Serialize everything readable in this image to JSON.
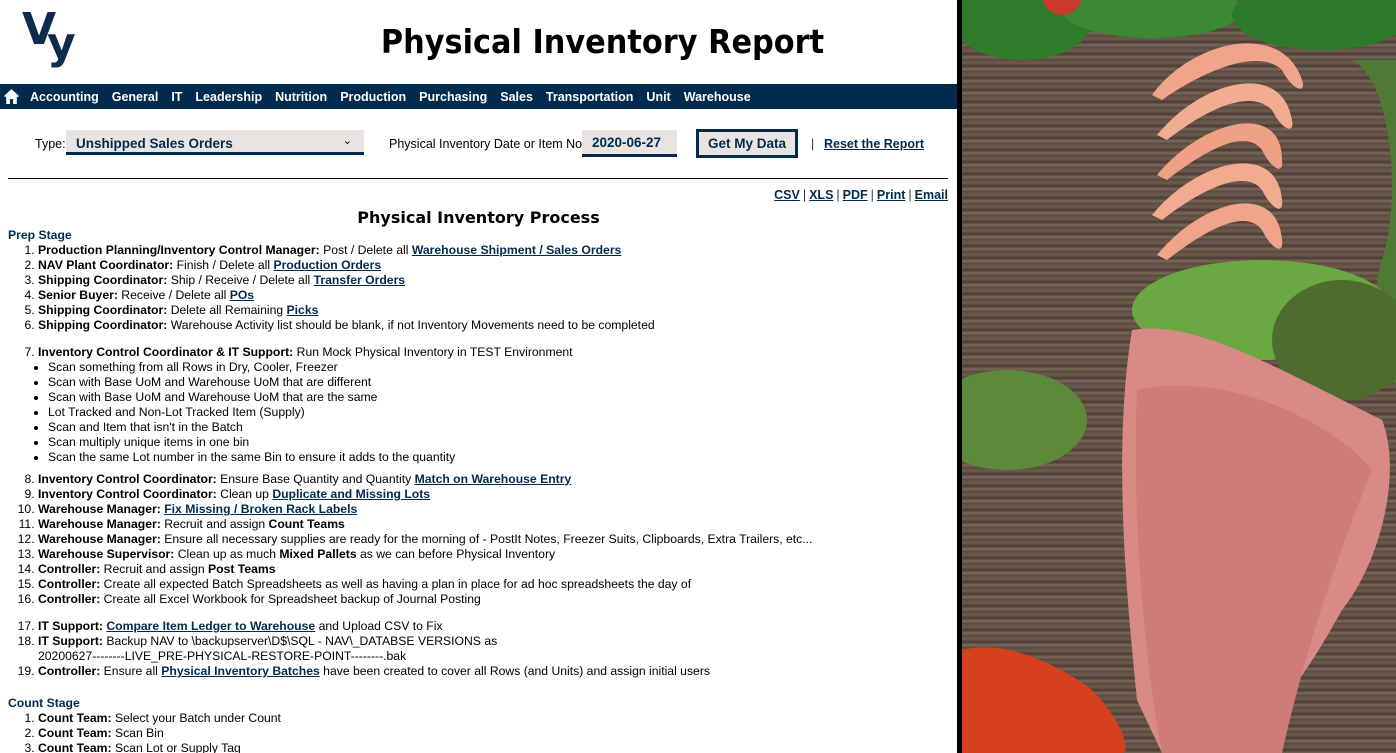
{
  "header": {
    "logo_text_v": "V",
    "logo_text_y": "y",
    "title": "Physical Inventory Report"
  },
  "nav": {
    "home_icon": "home-icon",
    "items": [
      {
        "label": "Accounting"
      },
      {
        "label": "General"
      },
      {
        "label": "IT"
      },
      {
        "label": "Leadership"
      },
      {
        "label": "Nutrition"
      },
      {
        "label": "Production"
      },
      {
        "label": "Purchasing"
      },
      {
        "label": "Sales"
      },
      {
        "label": "Transportation"
      },
      {
        "label": "Unit"
      },
      {
        "label": "Warehouse"
      }
    ]
  },
  "form": {
    "type_label": "Type:",
    "type_value": "Unshipped Sales Orders",
    "chevron": "⌄",
    "date_label": "Physical Inventory Date or Item No:",
    "date_value": "2020-06-27",
    "submit_label": "Get My Data",
    "separator": "|",
    "reset_label": "Reset the Report"
  },
  "exports": {
    "items": [
      "CSV",
      "XLS",
      "PDF",
      "Print",
      "Email"
    ],
    "separator": "|"
  },
  "process_title": "Physical Inventory Process",
  "prep_stage": {
    "heading": "Prep Stage",
    "steps": [
      {
        "role": "Production Planning/Inventory Control Manager:",
        "text": " Post / Delete all ",
        "link": "Warehouse Shipment / Sales Orders"
      },
      {
        "role": "NAV Plant Coordinator:",
        "text": " Finish / Delete all ",
        "link": "Production Orders"
      },
      {
        "role": "Shipping Coordinator:",
        "text": " Ship / Receive / Delete all ",
        "link": "Transfer Orders"
      },
      {
        "role": "Senior Buyer:",
        "text": " Receive / Delete all ",
        "link": "POs"
      },
      {
        "role": "Shipping Coordinator:",
        "text": " Delete all Remaining ",
        "link": "Picks"
      },
      {
        "role": "Shipping Coordinator:",
        "text": " Warehouse Activity list should be blank, if not Inventory Movements need to be completed"
      },
      {
        "role": "Inventory Control Coordinator & IT Support:",
        "text": " Run Mock Physical Inventory in TEST Environment"
      },
      {
        "role": "Inventory Control Coordinator:",
        "text": " Ensure Base Quantity and Quantity ",
        "link": "Match on Warehouse Entry"
      },
      {
        "role": "Inventory Control Coordinator:",
        "text": " Clean up ",
        "link": "Duplicate and Missing Lots"
      },
      {
        "role": "Warehouse Manager:",
        "text": " ",
        "link": "Fix Missing / Broken Rack Labels"
      },
      {
        "role": "Warehouse Manager:",
        "text": " Recruit and assign ",
        "bold_tail": "Count Teams"
      },
      {
        "role": "Warehouse Manager:",
        "text": " Ensure all necessary supplies are ready for the morning of - PostIt Notes, Freezer Suits, Clipboards, Extra Trailers, etc..."
      },
      {
        "role": "Warehouse Supervisor:",
        "text": " Clean up as much ",
        "bold_mid": "Mixed Pallets",
        "text2": " as we can before Physical Inventory"
      },
      {
        "role": "Controller:",
        "text": " Recruit and assign ",
        "bold_tail": "Post Teams"
      },
      {
        "role": "Controller:",
        "text": " Create all expected Batch Spreadsheets as well as having a plan in place for ad hoc spreadsheets the day of"
      },
      {
        "role": "Controller:",
        "text": " Create all Excel Workbook for Spreadsheet backup of Journal Posting"
      },
      {
        "role": "IT Support:",
        "text": " ",
        "link": "Compare Item Ledger to Warehouse",
        "text2": " and Upload CSV to Fix"
      },
      {
        "role": "IT Support:",
        "text": " Backup NAV to \\backupserver\\D$\\SQL - NAV\\_DATABSE VERSIONS as 20200627--------LIVE_PRE-PHYSICAL-RESTORE-POINT--------.bak"
      },
      {
        "role": "Controller:",
        "text": " Ensure all ",
        "link": "Physical Inventory Batches",
        "text2": " have been created to cover all Rows (and Units) and assign initial users"
      }
    ],
    "mock_bullets": [
      "Scan something from all Rows in Dry, Cooler, Freezer",
      "Scan with Base UoM and Warehouse UoM that are different",
      "Scan with Base UoM and Warehouse UoM that are the same",
      "Lot Tracked and Non-Lot Tracked Item (Supply)",
      "Scan and Item that isn't in the Batch",
      "Scan multiply unique items in one bin",
      "Scan the same Lot number in the same Bin to ensure it adds to the quantity"
    ]
  },
  "count_stage": {
    "heading": "Count Stage",
    "steps": [
      {
        "role": "Count Team:",
        "text": " Select your Batch under Count"
      },
      {
        "role": "Count Team:",
        "text": " Scan Bin"
      },
      {
        "role": "Count Team:",
        "text": " Scan Lot or Supply Tag"
      }
    ]
  },
  "side_image": {
    "description": "Raw shrimp, pork chop, crayfish and lettuce on wooden table"
  },
  "colors": {
    "brand_navy": "#012a4f",
    "input_bg": "#e8e4e2"
  }
}
